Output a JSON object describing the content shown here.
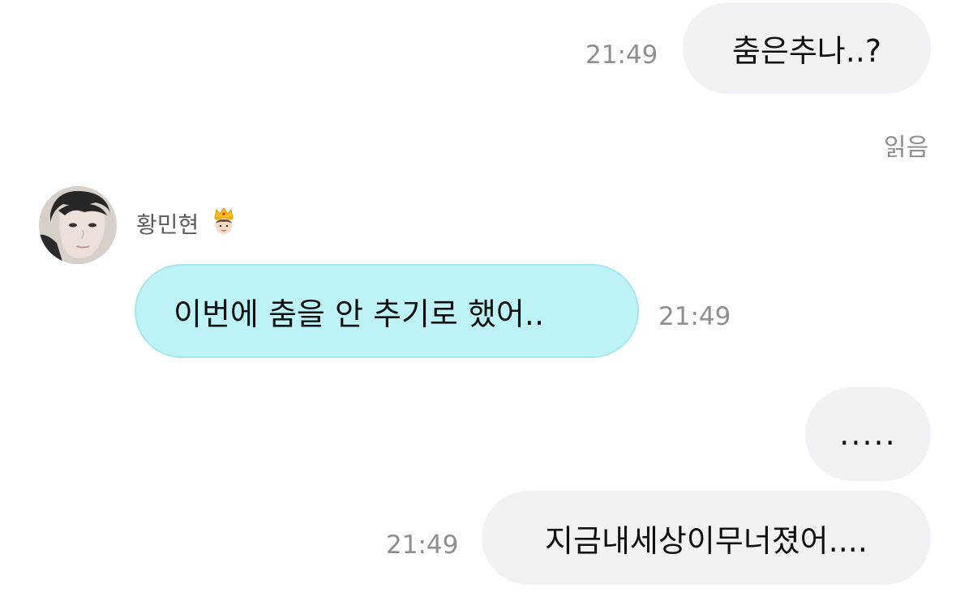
{
  "messages": [
    {
      "id": "m1",
      "direction": "outgoing",
      "text": "춤은추나..?",
      "time": "21:49"
    },
    {
      "id": "m2",
      "direction": "incoming",
      "text": "이번에 춤을 안 추기로 했어..",
      "time": "21:49"
    },
    {
      "id": "m3",
      "direction": "outgoing",
      "text": "....."
    },
    {
      "id": "m4",
      "direction": "outgoing",
      "text": "지금내세상이무너졌어....",
      "time": "21:49"
    }
  ],
  "read_receipt": "읽음",
  "sender": {
    "name": "황민현",
    "badge_icon": "crown-person-emoji"
  },
  "colors": {
    "outgoing_bubble": "#f2f2f6",
    "incoming_bubble": "#bdf2f6",
    "timestamp": "#8e8e93"
  }
}
